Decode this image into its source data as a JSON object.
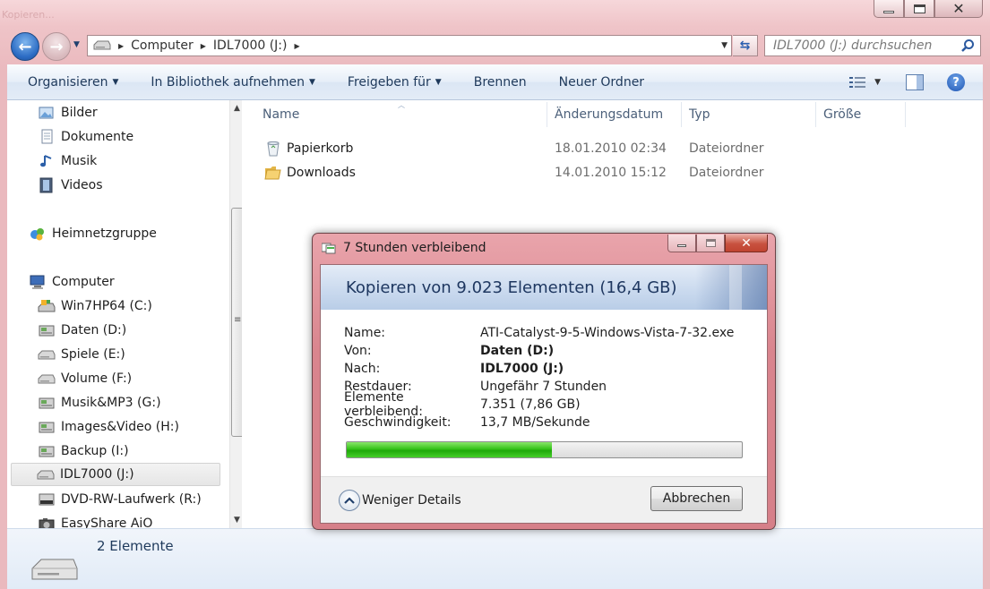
{
  "window": {
    "faint_title": "Kopieren..."
  },
  "address_bar": {
    "crumbs": [
      "Computer",
      "IDL7000 (J:)"
    ]
  },
  "search": {
    "placeholder": "IDL7000 (J:) durchsuchen"
  },
  "toolbar": {
    "organize": "Organisieren",
    "library": "In Bibliothek aufnehmen",
    "share": "Freigeben für",
    "burn": "Brennen",
    "new_folder": "Neuer Ordner"
  },
  "nav_pane": {
    "libraries": [
      {
        "label": "Bilder",
        "icon": "pictures-icon"
      },
      {
        "label": "Dokumente",
        "icon": "documents-icon"
      },
      {
        "label": "Musik",
        "icon": "music-icon"
      },
      {
        "label": "Videos",
        "icon": "videos-icon"
      }
    ],
    "homegroup": "Heimnetzgruppe",
    "computer": "Computer",
    "drives": [
      {
        "label": "Win7HP64 (C:)",
        "icon": "system-drive-icon"
      },
      {
        "label": "Daten (D:)",
        "icon": "hard-drive-icon"
      },
      {
        "label": "Spiele (E:)",
        "icon": "removable-drive-icon"
      },
      {
        "label": "Volume (F:)",
        "icon": "removable-drive-icon"
      },
      {
        "label": "Musik&MP3 (G:)",
        "icon": "hard-drive-icon"
      },
      {
        "label": "Images&Video (H:)",
        "icon": "hard-drive-icon"
      },
      {
        "label": "Backup (I:)",
        "icon": "hard-drive-icon"
      },
      {
        "label": "IDL7000 (J:)",
        "icon": "removable-drive-icon",
        "selected": true
      },
      {
        "label": "DVD-RW-Laufwerk (R:)",
        "icon": "dvd-drive-icon"
      },
      {
        "label": "EasyShare AiO",
        "icon": "camera-icon"
      }
    ]
  },
  "file_list": {
    "columns": [
      "Name",
      "Änderungsdatum",
      "Typ",
      "Größe"
    ],
    "rows": [
      {
        "name": "Papierkorb",
        "date": "18.01.2010 02:34",
        "type": "Dateiordner",
        "icon": "recycle-bin-icon"
      },
      {
        "name": "Downloads",
        "date": "14.01.2010 15:12",
        "type": "Dateiordner",
        "icon": "folder-icon"
      }
    ]
  },
  "details_bar": {
    "count": "2 Elemente"
  },
  "copy_dialog": {
    "title": "7 Stunden verbleibend",
    "heading": "Kopieren von 9.023 Elementen (16,4 GB)",
    "fields": [
      {
        "label": "Name:",
        "value": "ATI-Catalyst-9-5-Windows-Vista-7-32.exe",
        "bold": false
      },
      {
        "label": "Von:",
        "value": "Daten (D:)",
        "bold": true
      },
      {
        "label": "Nach:",
        "value": "IDL7000 (J:)",
        "bold": true
      },
      {
        "label": "Restdauer:",
        "value": "Ungefähr 7 Stunden",
        "bold": false
      },
      {
        "label": "Elemente verbleibend:",
        "value": "7.351 (7,86 GB)",
        "bold": false
      },
      {
        "label": "Geschwindigkeit:",
        "value": "13,7 MB/Sekunde",
        "bold": false
      }
    ],
    "progress_percent": 52,
    "less_details": "Weniger Details",
    "cancel": "Abbrechen"
  },
  "colors": {
    "frame_tint": "#efc4c8",
    "progress_green": "#34c219",
    "toolbar_text": "#1e395b"
  }
}
